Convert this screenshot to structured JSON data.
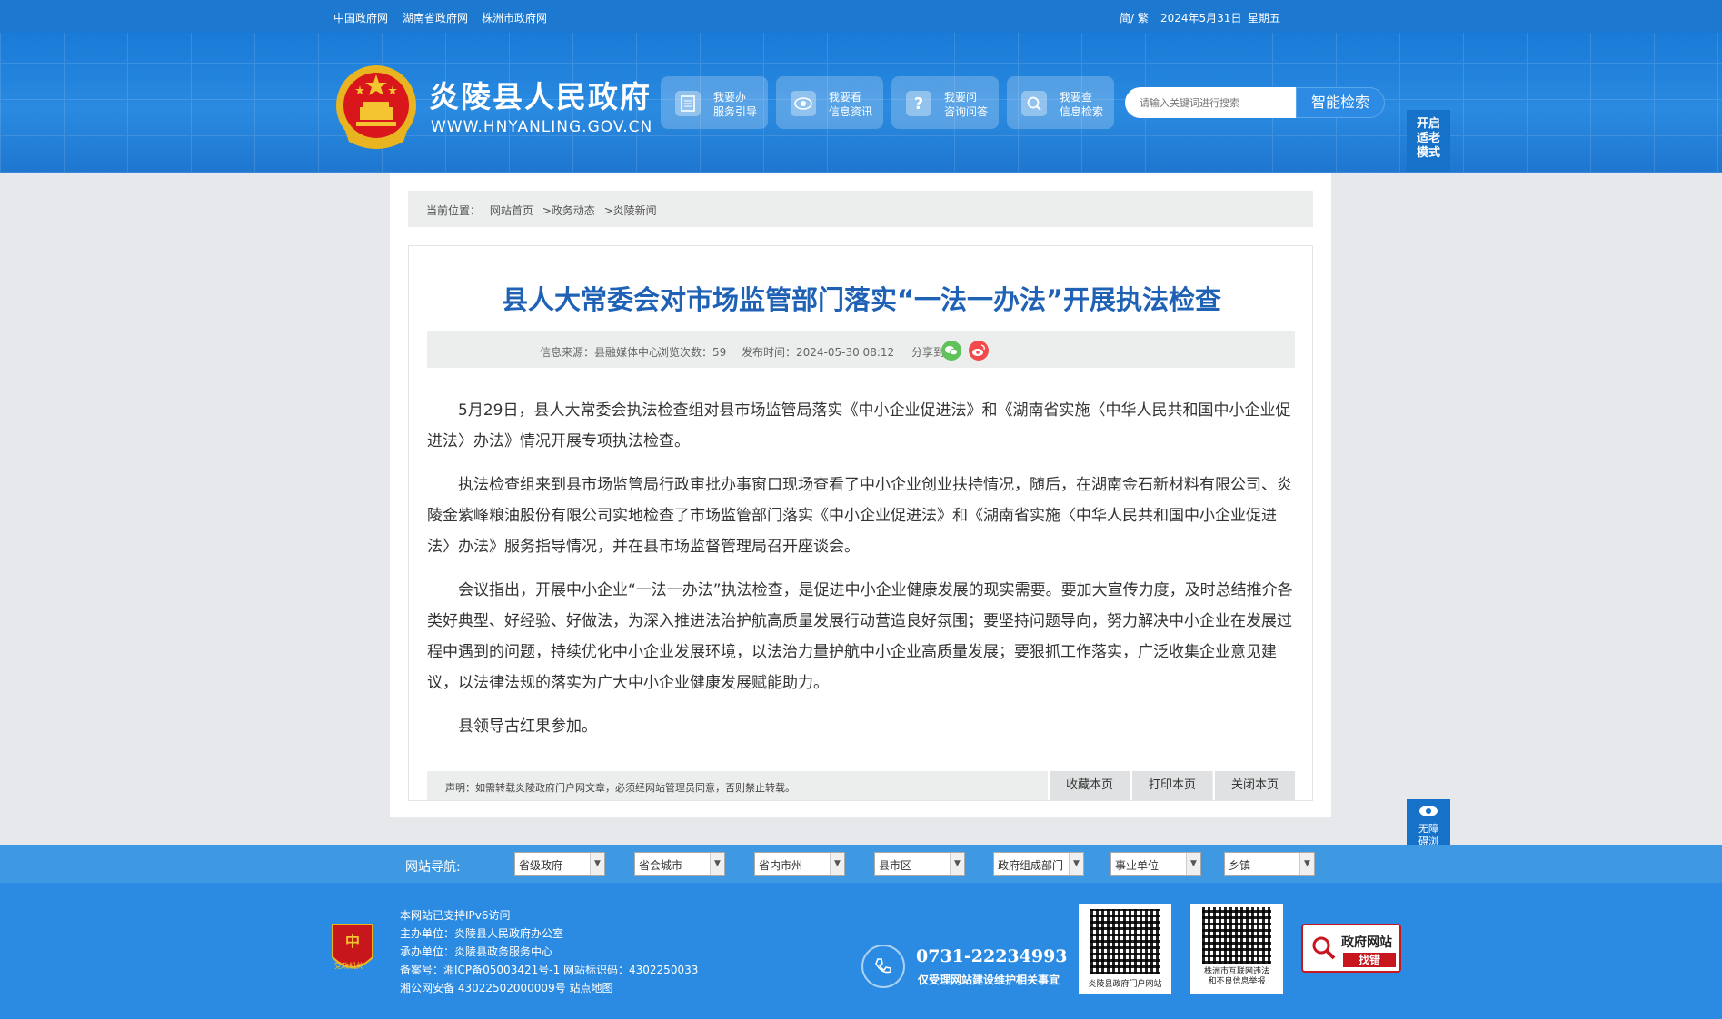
{
  "topbar": {
    "links": [
      "中国政府网",
      "湖南省政府网",
      "株洲市政府网"
    ],
    "lang": "简/ 繁",
    "date": "2024年5月31日",
    "weekday": "星期五"
  },
  "header": {
    "site_title": "炎陵县人民政府",
    "site_url": "WWW.HNYANLING.GOV.CN",
    "quick_links": [
      {
        "line1": "我要办",
        "line2": "服务引导",
        "icon": "document-icon"
      },
      {
        "line1": "我要看",
        "line2": "信息资讯",
        "icon": "eye-icon"
      },
      {
        "line1": "我要问",
        "line2": "咨询问答",
        "icon": "question-icon"
      },
      {
        "line1": "我要查",
        "line2": "信息检索",
        "icon": "search-icon"
      }
    ],
    "search_placeholder": "请输入关键词进行搜索",
    "search_button": "智能检索",
    "elder_mode": "开启适老模式"
  },
  "breadcrumb": {
    "label": "当前位置：",
    "items": [
      "网站首页",
      ">政务动态",
      ">炎陵新闻"
    ]
  },
  "article": {
    "title": "县人大常委会对市场监管部门落实“一法一办法”开展执法检查",
    "source": "信息来源：县融媒体中心",
    "views": "浏览次数：59",
    "published": "发布时间：2024-05-30 08:12",
    "share_label": "分享到",
    "paragraphs": [
      "5月29日，县人大常委会执法检查组对县市场监管局落实《中小企业促进法》和《湖南省实施〈中华人民共和国中小企业促进法〉办法》情况开展专项执法检查。",
      "执法检查组来到县市场监管局行政审批办事窗口现场查看了中小企业创业扶持情况，随后，在湖南金石新材料有限公司、炎陵金紫峰粮油股份有限公司实地检查了市场监管部门落实《中小企业促进法》和《湖南省实施〈中华人民共和国中小企业促进法〉办法》服务指导情况，并在县市场监督管理局召开座谈会。",
      "会议指出，开展中小企业“一法一办法”执法检查，是促进中小企业健康发展的现实需要。要加大宣传力度，及时总结推介各类好典型、好经验、好做法，为深入推进法治护航高质量发展行动营造良好氛围；要坚持问题导向，努力解决中小企业在发展过程中遇到的问题，持续优化中小企业发展环境，以法治力量护航中小企业高质量发展；要狠抓工作落实，广泛收集企业意见建议，以法律法规的落实为广大中小企业健康发展赋能助力。",
      "县领导古红果参加。"
    ],
    "statement": "声明：如需转载炎陵政府门户网文章，必须经网站管理员同意，否则禁止转载。",
    "actions": [
      "收藏本页",
      "打印本页",
      "关闭本页"
    ]
  },
  "accessibility": "无障碍浏览",
  "site_nav": {
    "label": "网站导航:",
    "selects": [
      "省级政府",
      "省会城市",
      "省内市州",
      "县市区",
      "政府组成部门",
      "事业单位",
      "乡镇"
    ]
  },
  "footer": {
    "lines": [
      "本网站已支持IPv6访问",
      "主办单位：炎陵县人民政府办公室",
      "承办单位：炎陵县政务服务中心",
      "备案号：湘ICP备05003421号-1 网站标识码：4302250033",
      "湘公网安备 43022502000009号 站点地图"
    ],
    "party_badge": "党政机关",
    "phone": "0731-22234993",
    "phone_note": "仅受理网站建设维护相关事宜",
    "qr1_caption": "炎陵县政府门户网站",
    "qr2_caption": "株洲市互联网违法和不良信息举报",
    "wzzc_title": "政府网站",
    "wzzc_button": "找错"
  },
  "colors": {
    "primary": "#1d78d0",
    "title_blue": "#1f62b5",
    "footer_blue": "#2b8be2",
    "wzzc_red": "#c7161e"
  }
}
